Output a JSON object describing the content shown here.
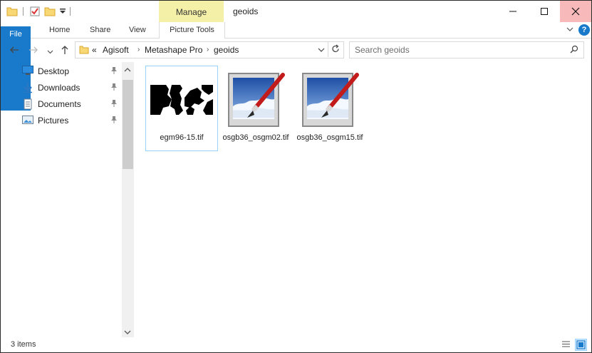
{
  "window": {
    "title": "geoids",
    "contextual_tab_group": "Manage"
  },
  "ribbon": {
    "tabs": [
      "File",
      "Home",
      "Share",
      "View",
      "Picture Tools"
    ],
    "help": "?"
  },
  "address": {
    "overflow": "«",
    "crumbs": [
      "Agisoft",
      "Metashape Pro",
      "geoids"
    ]
  },
  "search": {
    "placeholder": "Search geoids"
  },
  "sidebar": {
    "items": [
      {
        "label": "Desktop",
        "icon": "desktop-icon",
        "pinned": true
      },
      {
        "label": "Downloads",
        "icon": "downloads-icon",
        "pinned": true
      },
      {
        "label": "Documents",
        "icon": "documents-icon",
        "pinned": true
      },
      {
        "label": "Pictures",
        "icon": "pictures-icon",
        "pinned": true
      }
    ]
  },
  "files": [
    {
      "name": "egm96-15.tif",
      "icon": "geoid-map-thumbnail",
      "selected": true
    },
    {
      "name": "osgb36_osgm02.tif",
      "icon": "paint-image-icon",
      "selected": false
    },
    {
      "name": "osgb36_osgm15.tif",
      "icon": "paint-image-icon",
      "selected": false
    }
  ],
  "status": {
    "item_count": "3 items"
  },
  "colors": {
    "accent": "#1979ca",
    "manage_tab": "#f5f0a8",
    "close_hover": "#f7b9b9",
    "selection_border": "#99d1ff"
  }
}
